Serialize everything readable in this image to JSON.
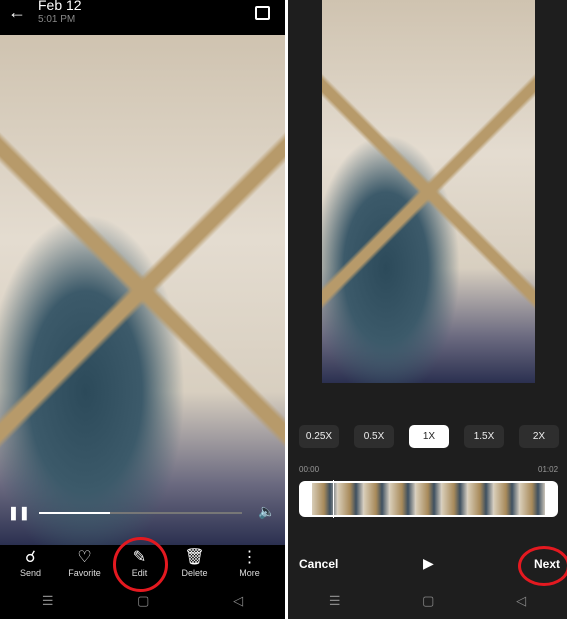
{
  "viewer": {
    "title": "Feb 12",
    "time": "5:01 PM",
    "progress": 0.35,
    "actions": [
      {
        "label": "Send",
        "icon": "share-icon"
      },
      {
        "label": "Favorite",
        "icon": "heart-icon"
      },
      {
        "label": "Edit",
        "icon": "edit-icon"
      },
      {
        "label": "Delete",
        "icon": "trash-icon"
      },
      {
        "label": "More",
        "icon": "more-icon"
      }
    ]
  },
  "editor": {
    "speeds": [
      "0.25X",
      "0.5X",
      "1X",
      "1.5X",
      "2X"
    ],
    "selected_speed": "1X",
    "start_time": "00:00",
    "end_time": "01:02",
    "cancel": "Cancel",
    "next": "Next"
  },
  "colors": {
    "highlight": "#e41920"
  }
}
